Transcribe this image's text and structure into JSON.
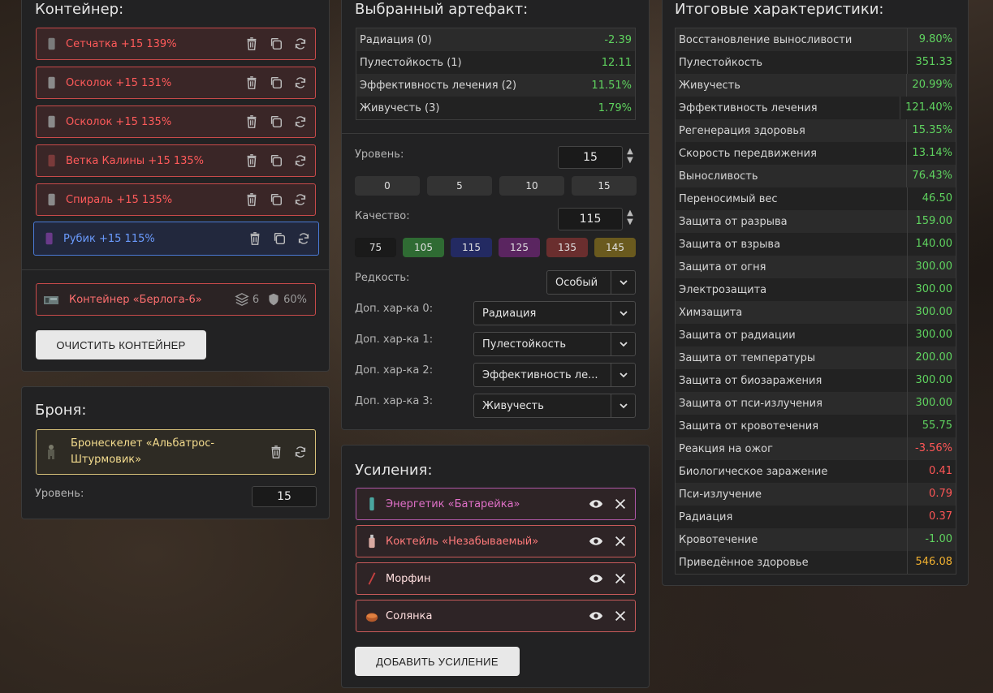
{
  "container": {
    "title": "Контейнер:",
    "artifacts": [
      {
        "name": "Сетчатка +15 139%"
      },
      {
        "name": "Осколок +15 131%"
      },
      {
        "name": "Осколок +15 135%"
      },
      {
        "name": "Ветка Калины +15 135%"
      },
      {
        "name": "Спираль +15 135%"
      },
      {
        "name": "Рубик +15 115%"
      }
    ],
    "container_item": {
      "name": "Контейнер «Берлога-6»",
      "slots": "6",
      "protection": "60%"
    },
    "clear_label": "ОЧИСТИТЬ КОНТЕЙНЕР"
  },
  "armor": {
    "title": "Броня:",
    "name_line1": "Бронескелет «Альбатрос-",
    "name_line2": "Штурмовик»",
    "level_label": "Уровень:",
    "level_value": "15"
  },
  "selected": {
    "title": "Выбранный артефакт:",
    "stats": [
      {
        "name": "Радиация (0)",
        "value": "-2.39",
        "color": "green"
      },
      {
        "name": "Пулестойкость (1)",
        "value": "12.11",
        "color": "green"
      },
      {
        "name": "Эффективность лечения (2)",
        "value": "11.51%",
        "color": "green"
      },
      {
        "name": "Живучесть (3)",
        "value": "1.79%",
        "color": "green"
      }
    ],
    "level_label": "Уровень:",
    "level_value": "15",
    "level_chips": [
      "0",
      "5",
      "10",
      "15"
    ],
    "quality_label": "Качество:",
    "quality_value": "115",
    "quality_chips": [
      {
        "label": "75",
        "color": "#1a1a1a"
      },
      {
        "label": "105",
        "color": "#2f6b33"
      },
      {
        "label": "115",
        "color": "#232a62"
      },
      {
        "label": "125",
        "color": "#5a2560"
      },
      {
        "label": "135",
        "color": "#6a2e2e"
      },
      {
        "label": "145",
        "color": "#6a5a1e"
      }
    ],
    "rarity_label": "Редкость:",
    "rarity_value": "Особый",
    "extra": [
      {
        "label": "Доп. хар-ка 0:",
        "value": "Радиация"
      },
      {
        "label": "Доп. хар-ка 1:",
        "value": "Пулестойкость"
      },
      {
        "label": "Доп. хар-ка 2:",
        "value": "Эффективность ле..."
      },
      {
        "label": "Доп. хар-ка 3:",
        "value": "Живучесть"
      }
    ]
  },
  "boosts": {
    "title": "Усиления:",
    "items": [
      {
        "name": "Энергетик «Батарейка»",
        "text_color": "#e070c8",
        "border": "#b058a8"
      },
      {
        "name": "Коктейль «Незабываемый»",
        "text_color": "#ff7a7a",
        "border": "#c85a5a"
      },
      {
        "name": "Морфин",
        "text_color": "#ffdede",
        "border": "#c85a5a"
      },
      {
        "name": "Солянка",
        "text_color": "#ffdede",
        "border": "#c85a5a"
      }
    ],
    "add_label": "ДОБАВИТЬ УСИЛЕНИЕ"
  },
  "totals": {
    "title": "Итоговые характеристики:",
    "rows": [
      {
        "name": "Восстановление выносливости",
        "value": "9.80%",
        "color": "green"
      },
      {
        "name": "Пулестойкость",
        "value": "351.33",
        "color": "green"
      },
      {
        "name": "Живучесть",
        "value": "20.99%",
        "color": "green"
      },
      {
        "name": "Эффективность лечения",
        "value": "121.40%",
        "color": "green"
      },
      {
        "name": "Регенерация здоровья",
        "value": "15.35%",
        "color": "green"
      },
      {
        "name": "Скорость передвижения",
        "value": "13.14%",
        "color": "green"
      },
      {
        "name": "Выносливость",
        "value": "76.43%",
        "color": "green"
      },
      {
        "name": "Переносимый вес",
        "value": "46.50",
        "color": "green"
      },
      {
        "name": "Защита от разрыва",
        "value": "159.00",
        "color": "green"
      },
      {
        "name": "Защита от взрыва",
        "value": "140.00",
        "color": "green"
      },
      {
        "name": "Защита от огня",
        "value": "300.00",
        "color": "green"
      },
      {
        "name": "Электрозащита",
        "value": "300.00",
        "color": "green"
      },
      {
        "name": "Химзащита",
        "value": "300.00",
        "color": "green"
      },
      {
        "name": "Защита от радиации",
        "value": "300.00",
        "color": "green"
      },
      {
        "name": "Защита от температуры",
        "value": "200.00",
        "color": "green"
      },
      {
        "name": "Защита от биозаражения",
        "value": "300.00",
        "color": "green"
      },
      {
        "name": "Защита от пси-излучения",
        "value": "300.00",
        "color": "green"
      },
      {
        "name": "Защита от кровотечения",
        "value": "55.75",
        "color": "green"
      },
      {
        "name": "Реакция на ожог",
        "value": "-3.56%",
        "color": "red"
      },
      {
        "name": "Биологическое заражение",
        "value": "0.41",
        "color": "red"
      },
      {
        "name": "Пси-излучение",
        "value": "0.79",
        "color": "red"
      },
      {
        "name": "Радиация",
        "value": "0.37",
        "color": "red"
      },
      {
        "name": "Кровотечение",
        "value": "-1.00",
        "color": "green"
      },
      {
        "name": "Приведённое здоровье",
        "value": "546.08",
        "color": "gold"
      }
    ]
  }
}
